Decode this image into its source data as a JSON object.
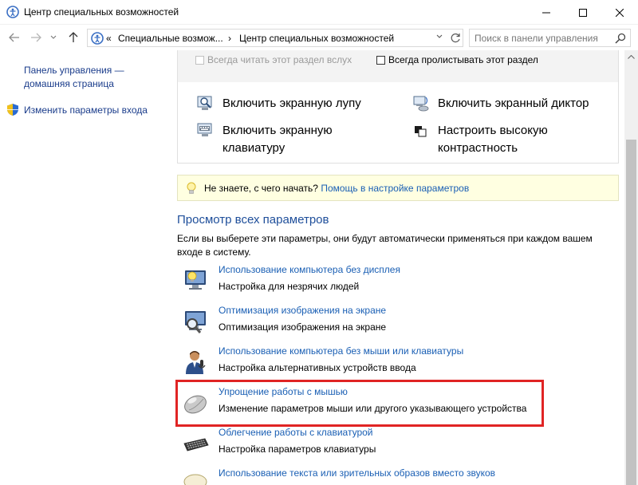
{
  "window": {
    "title": "Центр специальных возможностей",
    "min_glyph": "—",
    "max_glyph": "☐",
    "close_glyph": "✕"
  },
  "nav": {
    "back_glyph": "←",
    "forward_glyph": "→",
    "recent_glyph": "⌄",
    "up_glyph": "↑",
    "breadcrumb": [
      "«",
      "Специальные возмож...",
      "›",
      "Центр специальных возможностей"
    ],
    "dropdown_glyph": "⌄",
    "refresh_glyph": "↻",
    "search_placeholder": "Поиск в панели управления"
  },
  "sidebar": {
    "home_link": "Панель управления —\nдомашняя страница",
    "home_line1": "Панель управления —",
    "home_line2": "домашняя страница",
    "signin_link": "Изменить параметры входа"
  },
  "quick": {
    "always_read": "Всегда читать этот раздел вслух",
    "always_skip": "Всегда пролистывать этот раздел",
    "tools": [
      {
        "label": "Включить экранную лупу"
      },
      {
        "label": "Включить экранный диктор"
      },
      {
        "label_line1": "Включить экранную",
        "label_line2": "клавиатуру"
      },
      {
        "label_line1": "Настроить высокую",
        "label_line2": "контрастность"
      }
    ]
  },
  "tip": {
    "text": "Не знаете, с чего начать?",
    "link": "Помощь в настройке параметров"
  },
  "section": {
    "title": "Просмотр всех параметров",
    "description": "Если вы выберете эти параметры, они будут автоматически применяться при каждом вашем входе в систему."
  },
  "items": [
    {
      "link": "Использование компьютера без дисплея",
      "desc": "Настройка для незрячих людей",
      "icon": "monitor-lightbulb-icon"
    },
    {
      "link": "Оптимизация изображения на экране",
      "desc": "Оптимизация изображения на экране",
      "icon": "monitor-magnifier-icon"
    },
    {
      "link": "Использование компьютера без мыши или клавиатуры",
      "desc": "Настройка альтернативных устройств ввода",
      "icon": "person-microphone-icon"
    },
    {
      "link": "Упрощение работы с мышью",
      "desc": "Изменение параметров мыши или другого указывающего устройства",
      "icon": "mouse-icon"
    },
    {
      "link": "Облегчение работы с клавиатурой",
      "desc": "Настройка параметров клавиатуры",
      "icon": "keyboard-icon"
    },
    {
      "link": "Использование текста или зрительных образов вместо звуков",
      "desc": "",
      "icon": "speech-bubble-icon"
    }
  ],
  "colors": {
    "link": "#1a5fb4",
    "section_title": "#1e4e9a",
    "highlight": "#e02424",
    "tip_bg": "#ffffe1"
  }
}
